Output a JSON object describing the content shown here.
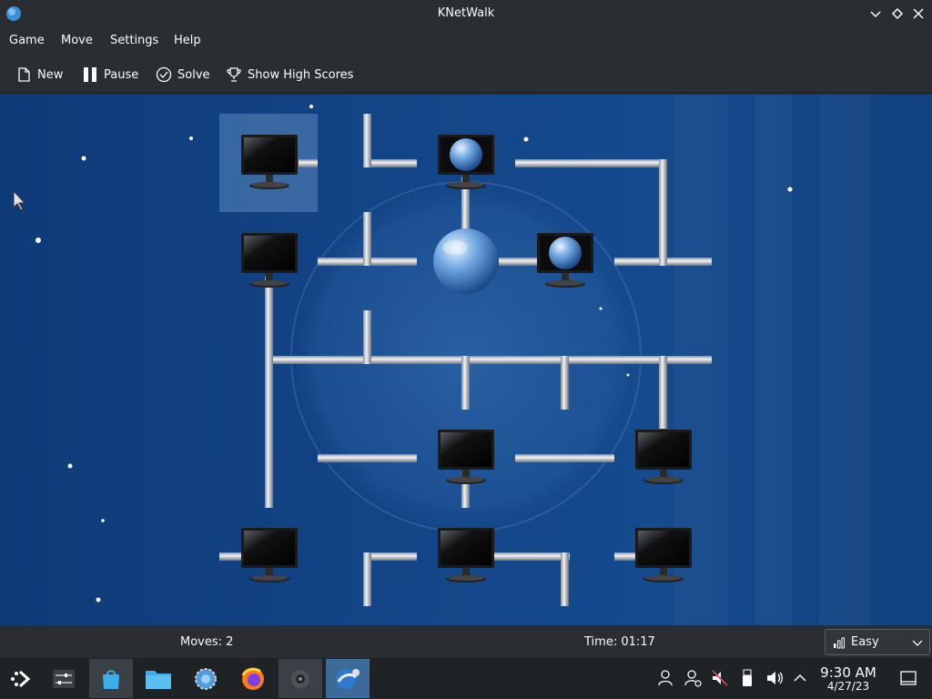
{
  "window": {
    "title": "KNetWalk"
  },
  "menu": {
    "items": [
      "Game",
      "Move",
      "Settings",
      "Help"
    ]
  },
  "toolbar": {
    "new_label": "New",
    "pause_label": "Pause",
    "solve_label": "Solve",
    "scores_label": "Show High Scores"
  },
  "status": {
    "moves": "Moves: 2",
    "time": "Time: 01:17",
    "difficulty": "Easy"
  },
  "clock": {
    "time": "9:30 AM",
    "date": "4/27/23"
  },
  "colors": {
    "accent": "#3daee9",
    "board_bg": "#134486",
    "panel": "#2a2e32"
  }
}
